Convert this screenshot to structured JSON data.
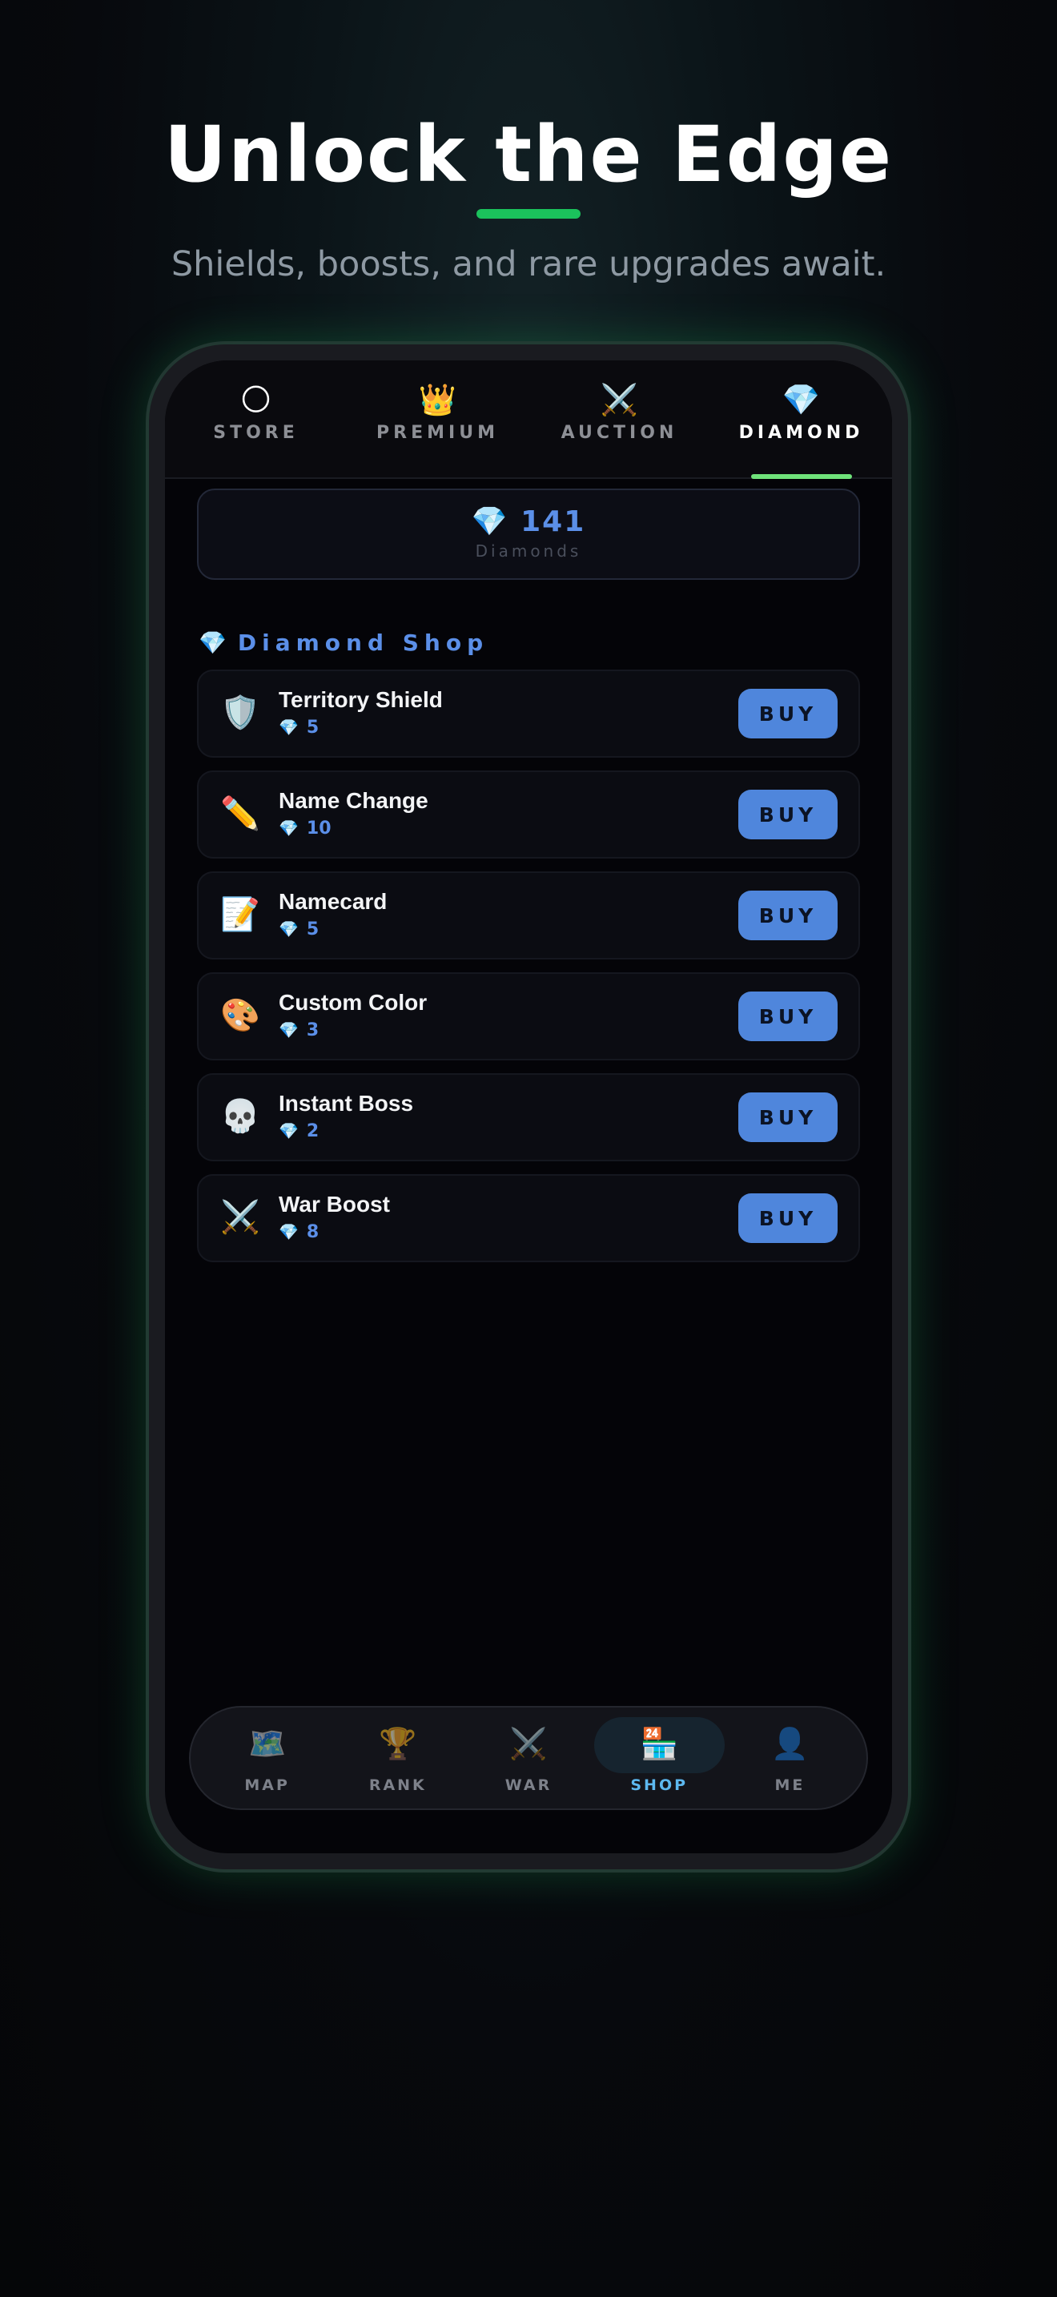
{
  "hero": {
    "title": "Unlock the Edge",
    "subtitle": "Shields, boosts, and rare upgrades await."
  },
  "tabs": [
    {
      "icon": "🌕",
      "icon_name": "moon-coin-icon",
      "label": "STORE",
      "active": false
    },
    {
      "icon": "👑",
      "icon_name": "crown-icon",
      "label": "PREMIUM",
      "active": false
    },
    {
      "icon": "⚔️",
      "icon_name": "crossed-swords-icon",
      "label": "AUCTION",
      "active": false
    },
    {
      "icon": "💎",
      "icon_name": "gem-icon",
      "label": "DIAMOND",
      "active": true
    }
  ],
  "balance": {
    "icon": "💎",
    "amount": "141",
    "label": "Diamonds"
  },
  "section": {
    "icon": "💎",
    "title": "Diamond Shop"
  },
  "items": [
    {
      "icon": "🛡️",
      "icon_name": "shield-icon",
      "name": "Territory Shield",
      "price": "5",
      "buy_label": "BUY"
    },
    {
      "icon": "✏️",
      "icon_name": "pencil-icon",
      "name": "Name Change",
      "price": "10",
      "buy_label": "BUY"
    },
    {
      "icon": "📝",
      "icon_name": "memo-icon",
      "name": "Namecard",
      "price": "5",
      "buy_label": "BUY"
    },
    {
      "icon": "🎨",
      "icon_name": "palette-icon",
      "name": "Custom Color",
      "price": "3",
      "buy_label": "BUY"
    },
    {
      "icon": "💀",
      "icon_name": "skull-icon",
      "name": "Instant Boss",
      "price": "2",
      "buy_label": "BUY"
    },
    {
      "icon": "⚔️",
      "icon_name": "crossed-swords-icon",
      "name": "War Boost",
      "price": "8",
      "buy_label": "BUY"
    }
  ],
  "price_icon": "💎",
  "bottom_nav": [
    {
      "icon": "🗺️",
      "icon_name": "map-icon",
      "label": "MAP",
      "active": false
    },
    {
      "icon": "🏆",
      "icon_name": "trophy-icon",
      "label": "RANK",
      "active": false
    },
    {
      "icon": "⚔️",
      "icon_name": "crossed-swords-icon",
      "label": "WAR",
      "active": false
    },
    {
      "icon": "🏪",
      "icon_name": "shop-icon",
      "label": "SHOP",
      "active": true
    },
    {
      "icon": "👤",
      "icon_name": "avatar-icon",
      "label": "ME",
      "active": false
    }
  ],
  "colors": {
    "accent_green": "#1bc25c",
    "tab_underline": "#6fe37a",
    "diamond_blue": "#5b8fe8",
    "buy_button": "#4f86dc",
    "nav_active": "#5db8ef"
  }
}
